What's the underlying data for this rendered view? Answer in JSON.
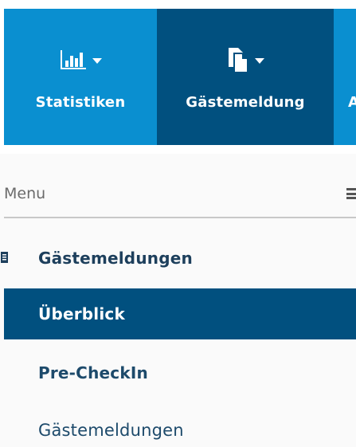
{
  "topnav": {
    "items": [
      {
        "label": "Statistiken",
        "icon": "bar-chart-icon",
        "has_dropdown": true
      },
      {
        "label": "Gästemeldung",
        "icon": "documents-icon",
        "has_dropdown": true,
        "active": true
      },
      {
        "label": "A",
        "icon": "",
        "has_dropdown": false
      }
    ]
  },
  "menu": {
    "title": "Menu",
    "section": {
      "label": "Gästemeldungen",
      "icon": "document-icon"
    },
    "items": [
      {
        "label": "Überblick",
        "active": true
      },
      {
        "label": "Pre-CheckIn",
        "active": false
      },
      {
        "label": "Gästemeldungen",
        "active": false
      }
    ]
  },
  "colors": {
    "nav_bg": "#0a8fd0",
    "nav_active_bg": "#01507f",
    "menu_active_bg": "#01507f",
    "menu_text": "#1d4a6b",
    "page_bg": "#fafafa"
  }
}
